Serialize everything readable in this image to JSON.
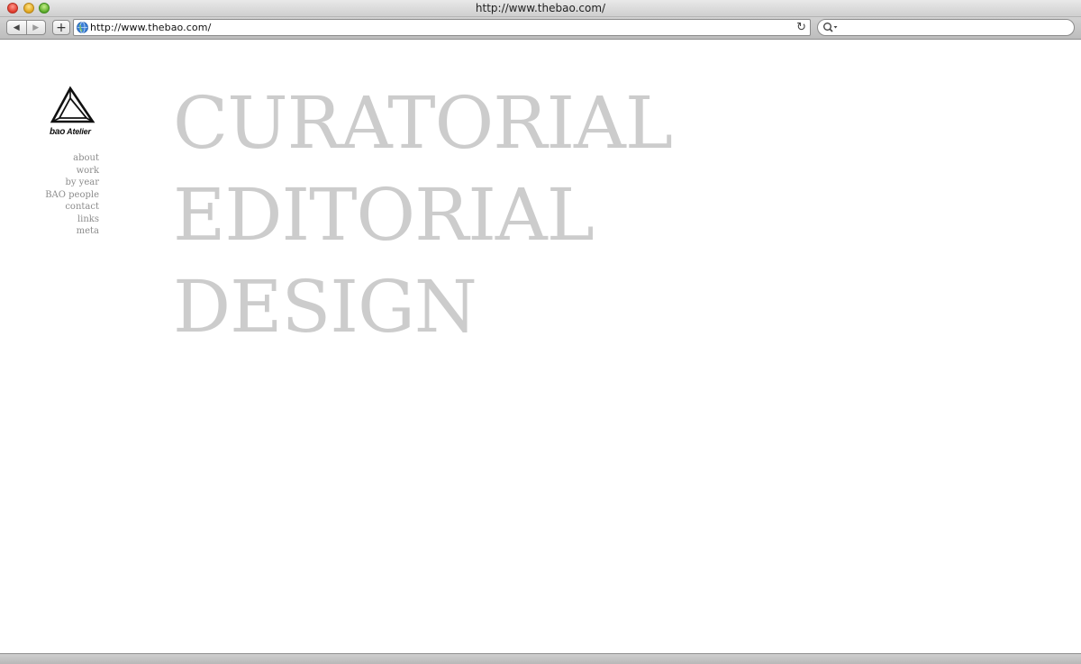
{
  "window": {
    "title": "http://www.thebao.com/"
  },
  "toolbar": {
    "back_icon": "◀",
    "forward_icon": "▶",
    "new_tab_icon": "+",
    "address": "http://www.thebao.com/",
    "reload_icon": "↻",
    "search_value": ""
  },
  "logo": {
    "brand_bold": "bao",
    "brand_rest": " Atelier"
  },
  "nav": {
    "items": [
      "about",
      "work",
      "by year",
      "BAO people",
      "contact",
      "links",
      "meta"
    ]
  },
  "headline": {
    "lines": [
      "CURATORIAL",
      "EDITORIAL",
      "DESIGN"
    ]
  },
  "colors": {
    "headline": "#cccccc",
    "nav": "#8c8c8c",
    "background": "#ffffff"
  }
}
